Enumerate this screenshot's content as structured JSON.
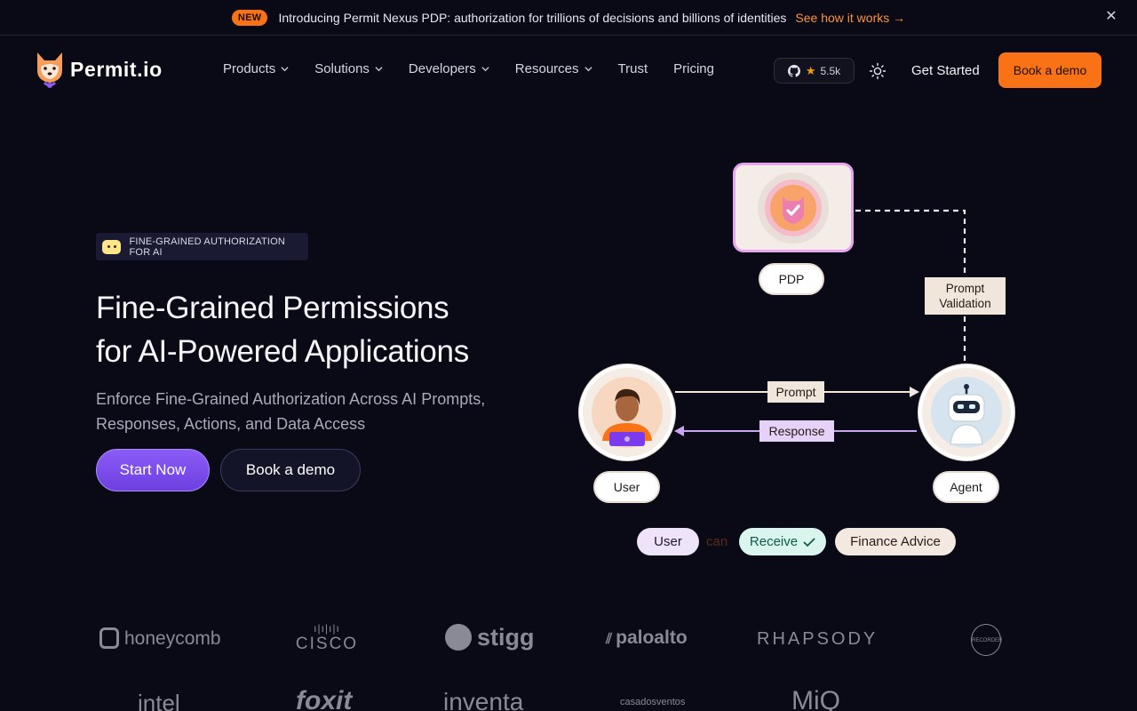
{
  "announcement": {
    "badge": "NEW",
    "message": "Introducing Permit Nexus PDP: authorization for trillions of decisions and billions of identities",
    "link": "See how it works →",
    "close_icon": "close-icon"
  },
  "nav": {
    "brand": "Permit.io",
    "items": [
      {
        "label": "Products",
        "has_dropdown": true
      },
      {
        "label": "Solutions",
        "has_dropdown": true
      },
      {
        "label": "Developers",
        "has_dropdown": true
      },
      {
        "label": "Resources",
        "has_dropdown": true
      },
      {
        "label": "Trust",
        "has_dropdown": false
      },
      {
        "label": "Pricing",
        "has_dropdown": false
      }
    ],
    "github_stars": "5.5k",
    "get_started": "Get Started",
    "book_demo": "Book a demo"
  },
  "hero": {
    "tag": "FINE-GRAINED AUTHORIZATION FOR AI",
    "headline_line1": "Fine-Grained Permissions",
    "headline_line2": "for AI-Powered Applications",
    "subtitle": "Enforce Fine-Grained Authorization Across AI Prompts, Responses, Actions, and Data Access",
    "cta_primary": "Start Now",
    "cta_secondary": "Book a demo"
  },
  "diagram": {
    "pdp_label": "PDP",
    "prompt_validation": "Prompt Validation",
    "user_label": "User",
    "agent_label": "Agent",
    "prompt_arrow": "Prompt",
    "response_arrow": "Response",
    "rule": {
      "subject": "User",
      "verb": "can",
      "action": "Receive",
      "resource": "Finance Advice"
    }
  },
  "logos": {
    "row1": [
      "honeycomb",
      "CISCO",
      "stigg",
      "paloalto",
      "RHAPSODY",
      "RECORDER"
    ],
    "row2": [
      "intel",
      "foxit",
      "inventa",
      "casadosventos",
      "MiQ"
    ]
  },
  "colors": {
    "accent_orange": "#f97316",
    "accent_purple": "#8b5cf6",
    "background": "#0a0a17"
  }
}
